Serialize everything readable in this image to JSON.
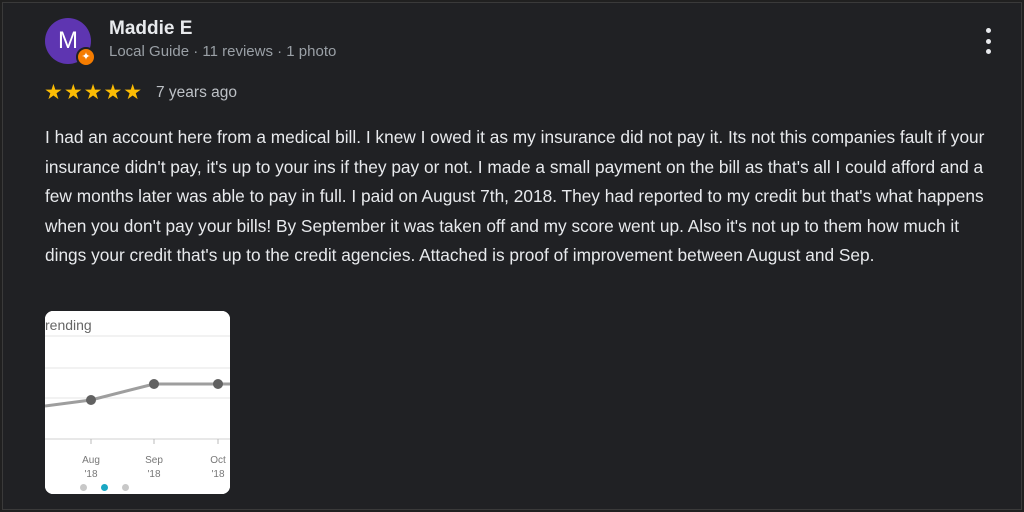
{
  "reviewer": {
    "initial": "M",
    "name": "Maddie E",
    "meta": "Local Guide · 11 reviews · 1 photo"
  },
  "rating": {
    "stars": "★★★★★",
    "value": 5,
    "age": "7 years ago"
  },
  "review_text": "I had an account here from a medical bill. I knew I owed it as my insurance did not pay it. Its not this companies fault if your insurance didn't pay, it's up to your ins if they pay or not. I made a small payment on the bill as that's all I could afford and a few months later was able to pay in full. I paid on August 7th, 2018. They had reported to my credit but that's what happens when you don't pay your bills! By September it was taken off and my score went up. Also it's not up to them how much it dings your credit that's up to the credit agencies. Attached is proof of improvement between August and Sep.",
  "photo": {
    "caption": "rending",
    "x_labels": [
      {
        "month": "Aug",
        "year": "'18"
      },
      {
        "month": "Sep",
        "year": "'18"
      },
      {
        "month": "Oct",
        "year": "'18"
      }
    ]
  },
  "colors": {
    "background": "#202124",
    "avatar": "#5e35b1",
    "badge": "#f57c00",
    "star": "#fbbc04",
    "active_dot": "#1aa7c3"
  },
  "icons": {
    "menu": "more-vert-icon",
    "badge": "local-guide-icon"
  }
}
